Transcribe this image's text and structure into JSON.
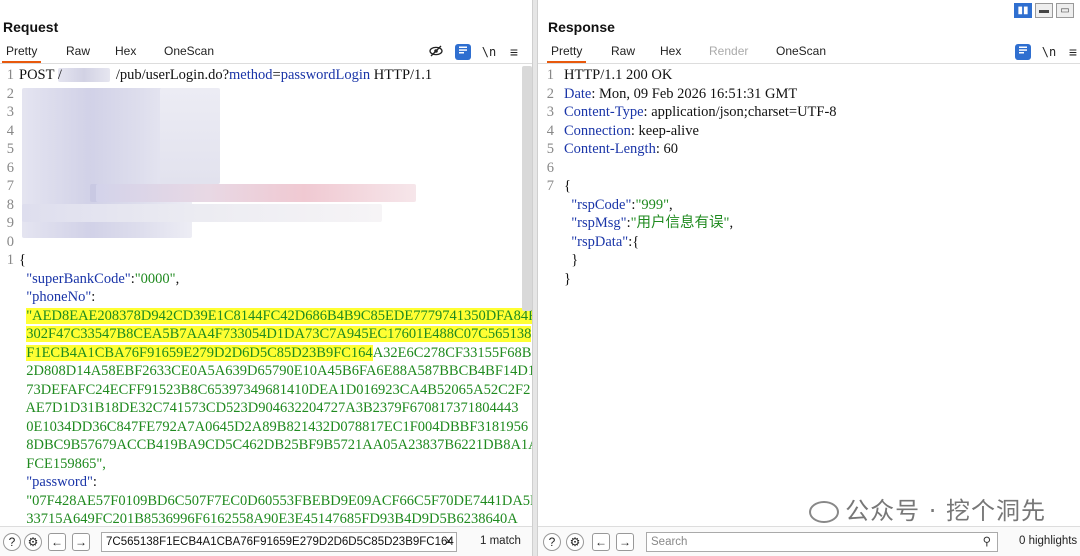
{
  "request": {
    "title": "Request",
    "tabs": [
      "Pretty",
      "Raw",
      "Hex",
      "OneScan"
    ],
    "line_numbers": [
      "1",
      "2",
      "3",
      "4",
      "5",
      "6",
      "7",
      "8",
      "9",
      "0",
      "1"
    ],
    "line1": {
      "method": "POST",
      "slash": "/",
      "path": "/pub/userLogin.do?",
      "param": "method",
      "eq": "=",
      "value": "passwordLogin",
      "proto": " HTTP/1.1"
    },
    "json_open": "{",
    "superBankCode_key": "\"superBankCode\"",
    "superBankCode_val": "\"0000\"",
    "phoneNo_key": "\"phoneNo\"",
    "phone_hl_1": "\"AED8EAE208378D942CD39E1C8144FC42D686B4B9C85EDE7779741350DFA84F",
    "phone_hl_2": "302F47C33547B8CEA5B7AA4F733054D1DA73C7A945EC17601E488C07C565138",
    "phone_hl_3": "F1ECB4A1CBA76F91659E279D2D6D5C85D23B9FC164",
    "phone_rest_3": "A32E6C278CF33155F68B0",
    "phone_4": "2D808D14A58EBF2633CE0A5A639D65790E10A45B6FA6E88A587BBCB4BF14D1D",
    "phone_5": "73DEFAFC24ECFF91523B8C65397349681410DEA1D016923CA4B52065A52C2F2",
    "phone_6": "AE7D1D31B18DE32C741573CD523D904632204727A3B2379F670817371804443",
    "phone_7": "0E1034DD36C847FE792A7A0645D2A89B821432D078817EC1F004DBBF3181956",
    "phone_8": "8DBC9B57679ACCB419BA9CD5C462DB25BF9B5721AA05A23837B6221DB8A1AC7",
    "phone_9": "FCE159865\",",
    "password_key": "\"password\"",
    "pw_1": "\"07F428AE57F0109BD6C507F7EC0D60553FBEBD9E09ACF66C5F70DE7441DA5D",
    "pw_2": "33715A649FC201B8536996F6162558A90E3E45147685FD93B4D9D5B6238640A",
    "search_value": "7C565138F1ECB4A1CBA76F91659E279D2D6D5C85D23B9FC164",
    "match_text": "1 match"
  },
  "response": {
    "title": "Response",
    "tabs": [
      "Pretty",
      "Raw",
      "Hex",
      "Render",
      "OneScan"
    ],
    "line_numbers": [
      "1",
      "2",
      "3",
      "4",
      "5",
      "6",
      "7"
    ],
    "status": "HTTP/1.1 200 OK",
    "date_key": "Date",
    "date_val": " Mon, 09 Feb 2026 16:51:31 GMT",
    "ct_key": "Content-Type",
    "ct_val": " application/json;charset=UTF-8",
    "conn_key": "Connection",
    "conn_val": " keep-alive",
    "cl_key": "Content-Length",
    "cl_val": " 60",
    "json_open": "{",
    "rspCode_key": "\"rspCode\"",
    "rspCode_val": "\"999\"",
    "rspMsg_key": "\"rspMsg\"",
    "rspMsg_val": "\"用户信息有误\"",
    "rspData_key": "\"rspData\"",
    "rspData_open": "{",
    "rspData_close": "}",
    "json_close": "}",
    "search_placeholder": "Search",
    "highlights_text": "0 highlights"
  },
  "watermark": "公众号 · 挖个洞先",
  "colors": {
    "accent": "#e8590c",
    "blue": "#2f6fd0",
    "highlight": "#ffff33",
    "string": "#1f8a1f",
    "key": "#1a35a8"
  }
}
